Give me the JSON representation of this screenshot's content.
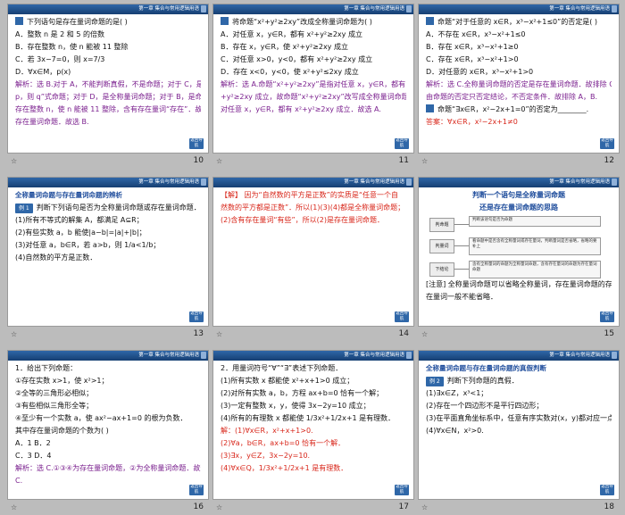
{
  "header": "第一章  集合与常用逻辑用语",
  "return_label": "返回导航",
  "slides": [
    {
      "num": "10",
      "lines": [
        {
          "t": "下列语句是存在量词命题的是(      )",
          "c": "",
          "marker": true
        },
        {
          "t": "A．整数 n 是 2 和 5 的倍数",
          "c": ""
        },
        {
          "t": "B．存在整数 n，使 n 能被 11 整除",
          "c": ""
        },
        {
          "t": "C．若 3x−7=0，则 x=7/3",
          "c": ""
        },
        {
          "t": "D．∀x∈M，p(x)",
          "c": ""
        },
        {
          "t": "解析：选 B.对于 A，不能判断真假，不是命题；对于 C，是“若",
          "c": "purple"
        },
        {
          "t": "p，则 q”式命题；对于 D，是全称量词命题；对于 B，是命题且",
          "c": "purple"
        },
        {
          "t": "存在整数 n，使 n 能被 11 整除，含有存在量词“存在”．故 B 是",
          "c": "purple"
        },
        {
          "t": "存在量词命题．故选 B.",
          "c": "purple"
        }
      ]
    },
    {
      "num": "11",
      "lines": [
        {
          "t": "将命题“x²+y²≥2xy”改成全称量词命题为(      )",
          "c": "",
          "marker": true
        },
        {
          "t": "A．对任意 x，y∈R，都有 x²+y²≥2xy 成立",
          "c": ""
        },
        {
          "t": "B．存在 x，y∈R，使 x²+y²≥2xy 成立",
          "c": ""
        },
        {
          "t": "C．对任意 x>0，y<0，都有 x²+y²≥2xy 成立",
          "c": ""
        },
        {
          "t": "D．存在 x<0，y<0，使 x²+y²≤2xy 成立",
          "c": ""
        },
        {
          "t": "解析：选 A.命题“x²+y²≥2xy”是指对任意 x，y∈R，都有 x²",
          "c": "purple"
        },
        {
          "t": "+y²≥2xy 成立，故命题“x²+y²≥2xy”改写成全称量词命题为",
          "c": "purple"
        },
        {
          "t": "对任意 x，y∈R，都有 x²+y²≥2xy 成立．故选 A.",
          "c": "purple"
        }
      ]
    },
    {
      "num": "12",
      "lines": [
        {
          "t": "命题“对于任意的 x∈R，x³−x²+1≤0”的否定是(      )",
          "c": "",
          "marker": true
        },
        {
          "t": "A．不存在 x∈R，x³−x²+1≤0",
          "c": ""
        },
        {
          "t": "B．存在 x∈R，x³−x²+1≥0",
          "c": ""
        },
        {
          "t": "C．存在 x∈R，x³−x²+1>0",
          "c": ""
        },
        {
          "t": "D．对任意的 x∈R，x³−x²+1>0",
          "c": ""
        },
        {
          "t": "解析：选 C.全称量词命题的否定是存在量词命题．故排除 C；",
          "c": "purple"
        },
        {
          "t": "由命题的否定只否定结论，不否定条件．故排除 A，B.",
          "c": "purple"
        },
        {
          "t": "命题“∃x∈R，x²−2x+1=0”的否定为________.",
          "c": "",
          "marker": true
        },
        {
          "t": "答案：∀x∈R，x²−2x+1≠0",
          "c": "red"
        }
      ]
    },
    {
      "num": "13",
      "title": "全称量词命题与存在量词命题的辨析",
      "lines": [
        {
          "t": "判断下列语句是否为全称量词命题或存在量词命题．",
          "c": "",
          "tag": "例 1"
        },
        {
          "t": "(1)所有不等式的解集 A，都满足 A⊆R；",
          "c": ""
        },
        {
          "t": "(2)有些实数 a，b 能使|a−b|=|a|+|b|；",
          "c": ""
        },
        {
          "t": "(3)对任意 a，b∈R，若 a>b，则 1/a<1/b；",
          "c": ""
        },
        {
          "t": "(4)自然数的平方是正数．",
          "c": ""
        }
      ]
    },
    {
      "num": "14",
      "lines": [
        {
          "t": "【解】  因为“自然数的平方是正数”的实质是“任意一个自",
          "c": "red"
        },
        {
          "t": "然数的平方都是正数”．所以(1)(3)(4)都是全称量词命题；",
          "c": "red"
        },
        {
          "t": "(2)含有存在量词“有些”，所以(2)是存在量词命题．",
          "c": "red"
        }
      ]
    },
    {
      "num": "15",
      "title": "判断一个语句是全称量词命题",
      "subtitle": "还是存在量词命题的思路",
      "flow": {
        "d1": "判命题",
        "d2": "判量词",
        "d3": "下结论",
        "b1": "判断该语句是否为命题",
        "b2": "看命题中是否含有全称量词或存在量词，判断量词是否省略，省略的要补上",
        "b3": "含有全称量词的命题为全称量词命题，含有存在量词的命题为存在量词命题"
      },
      "lines": [
        {
          "t": "[注意]  全称量词命题可以省略全称量词，存在量词命题的存",
          "c": ""
        },
        {
          "t": "在量词一般不能省略．",
          "c": ""
        }
      ]
    },
    {
      "num": "16",
      "lines": [
        {
          "t": "1．给出下列命题：",
          "c": ""
        },
        {
          "t": "①存在实数 x>1，使 x²>1；",
          "c": ""
        },
        {
          "t": "②全等的三角形必相似；",
          "c": ""
        },
        {
          "t": "③有些相似三角形全等；",
          "c": ""
        },
        {
          "t": "④至少有一个实数 a，使 ax²−ax+1=0 的根为负数．",
          "c": ""
        },
        {
          "t": "其中存在量词命题的个数为(      )",
          "c": ""
        },
        {
          "t": "A．1                          B．2",
          "c": ""
        },
        {
          "t": "C．3                          D．4",
          "c": ""
        },
        {
          "t": "解析：选 C.①③④为存在量词命题，②为全称量词命题．故选",
          "c": "purple"
        },
        {
          "t": "C.",
          "c": "purple"
        }
      ]
    },
    {
      "num": "17",
      "lines": [
        {
          "t": "2．用量词符号“∀”“∃”表述下列命题．",
          "c": ""
        },
        {
          "t": "(1)所有实数 x 都能使 x²+x+1>0 成立；",
          "c": ""
        },
        {
          "t": "(2)对所有实数 a，b，方程 ax+b=0 恰有一个解；",
          "c": ""
        },
        {
          "t": "(3)一定有整数 x，y，使得 3x−2y=10 成立；",
          "c": ""
        },
        {
          "t": "(4)所有的有理数 x 都能使 1/3x²+1/2x+1 是有理数．",
          "c": ""
        },
        {
          "t": "解：(1)∀x∈R，x²+x+1>0.",
          "c": "red"
        },
        {
          "t": "(2)∀a，b∈R，ax+b=0 恰有一个解．",
          "c": "red"
        },
        {
          "t": "(3)∃x，y∈Z，3x−2y=10.",
          "c": "red"
        },
        {
          "t": "(4)∀x∈Q，1/3x²+1/2x+1 是有理数．",
          "c": "red"
        }
      ]
    },
    {
      "num": "18",
      "title": "全称量词命题与存在量词命题的真假判断",
      "lines": [
        {
          "t": "判断下列命题的真假．",
          "c": "",
          "tag": "例 2"
        },
        {
          "t": "(1)∃x∈Z，x³<1；",
          "c": ""
        },
        {
          "t": "(2)存在一个四边形不是平行四边形；",
          "c": ""
        },
        {
          "t": "(3)在平面直角坐标系中，任意有序实数对(x，y)都对应一点 P；",
          "c": ""
        },
        {
          "t": "(4)∀x∈N，x²>0.",
          "c": ""
        }
      ]
    }
  ]
}
